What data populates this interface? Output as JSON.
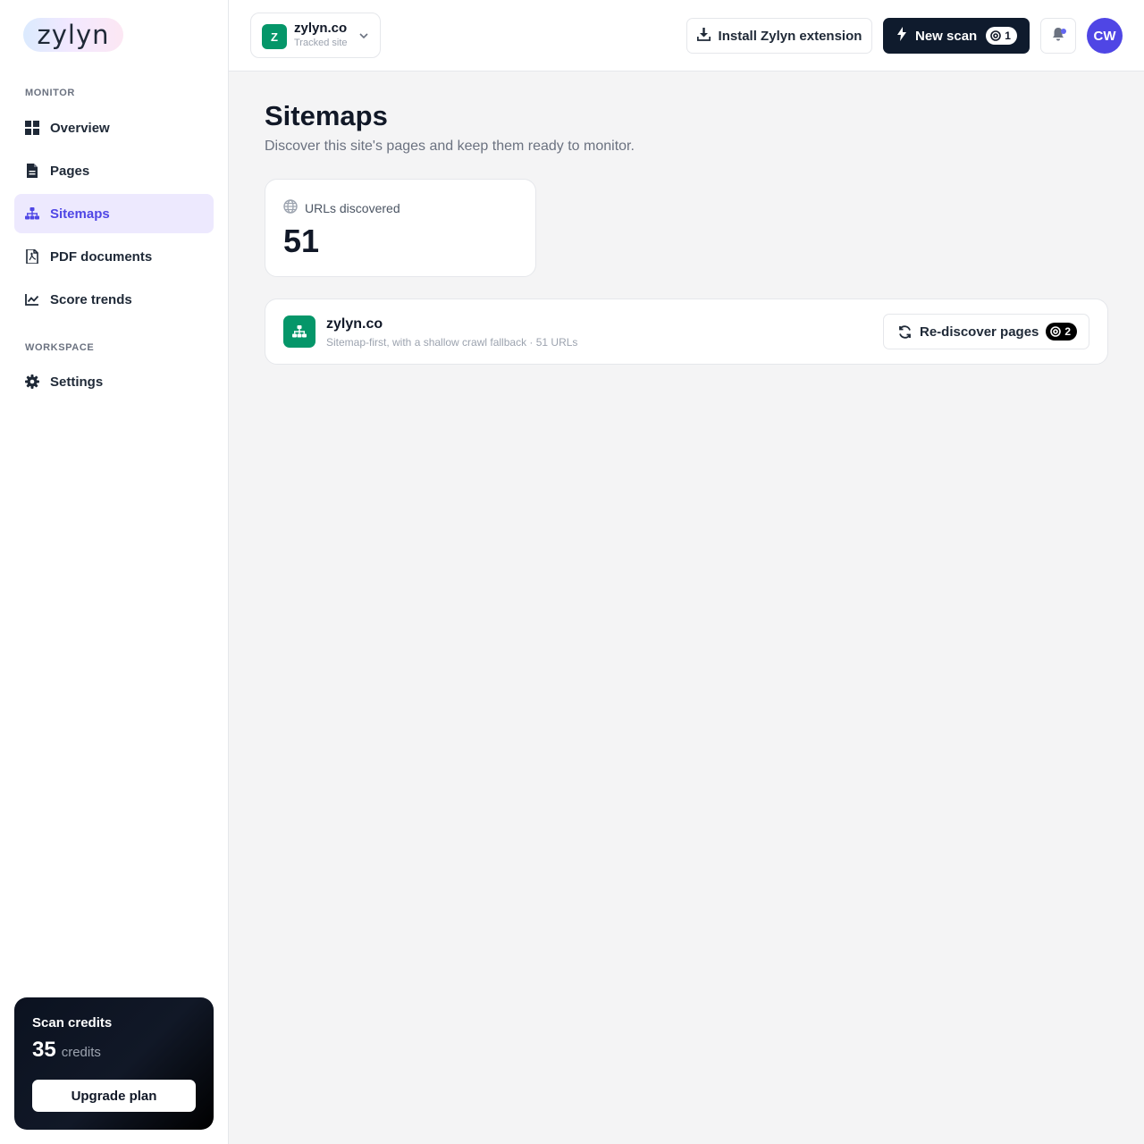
{
  "brand": {
    "logo_text": "zylyn"
  },
  "sidebar": {
    "sections": [
      {
        "label": "MONITOR"
      },
      {
        "label": "WORKSPACE"
      }
    ],
    "items": [
      {
        "label": "Overview",
        "icon": "grid-icon"
      },
      {
        "label": "Pages",
        "icon": "document-icon"
      },
      {
        "label": "Sitemaps",
        "icon": "sitemap-icon",
        "active": true
      },
      {
        "label": "PDF documents",
        "icon": "pdf-icon"
      },
      {
        "label": "Score trends",
        "icon": "chart-line-icon"
      },
      {
        "label": "Settings",
        "icon": "gear-icon"
      }
    ],
    "credits": {
      "title": "Scan credits",
      "amount": "35",
      "unit": "credits",
      "upgrade_label": "Upgrade plan"
    }
  },
  "header": {
    "site": {
      "initial": "Z",
      "name": "zylyn.co",
      "subtitle": "Tracked site"
    },
    "install_label": "Install Zylyn extension",
    "new_scan_label": "New scan",
    "new_scan_cost": "1",
    "user_initials": "CW"
  },
  "main": {
    "title": "Sitemaps",
    "subtitle": "Discover this site's pages and keep them ready to monitor.",
    "stat": {
      "label": "URLs discovered",
      "value": "51"
    },
    "sitemap": {
      "name": "zylyn.co",
      "description": "Sitemap-first, with a shallow crawl fallback · 51 URLs",
      "rediscover_label": "Re-discover pages",
      "rediscover_cost": "2"
    }
  },
  "colors": {
    "accent": "#4f46e5",
    "active_bg": "#ede9fe",
    "site_green": "#059669",
    "dark_button": "#0f1b2d"
  }
}
